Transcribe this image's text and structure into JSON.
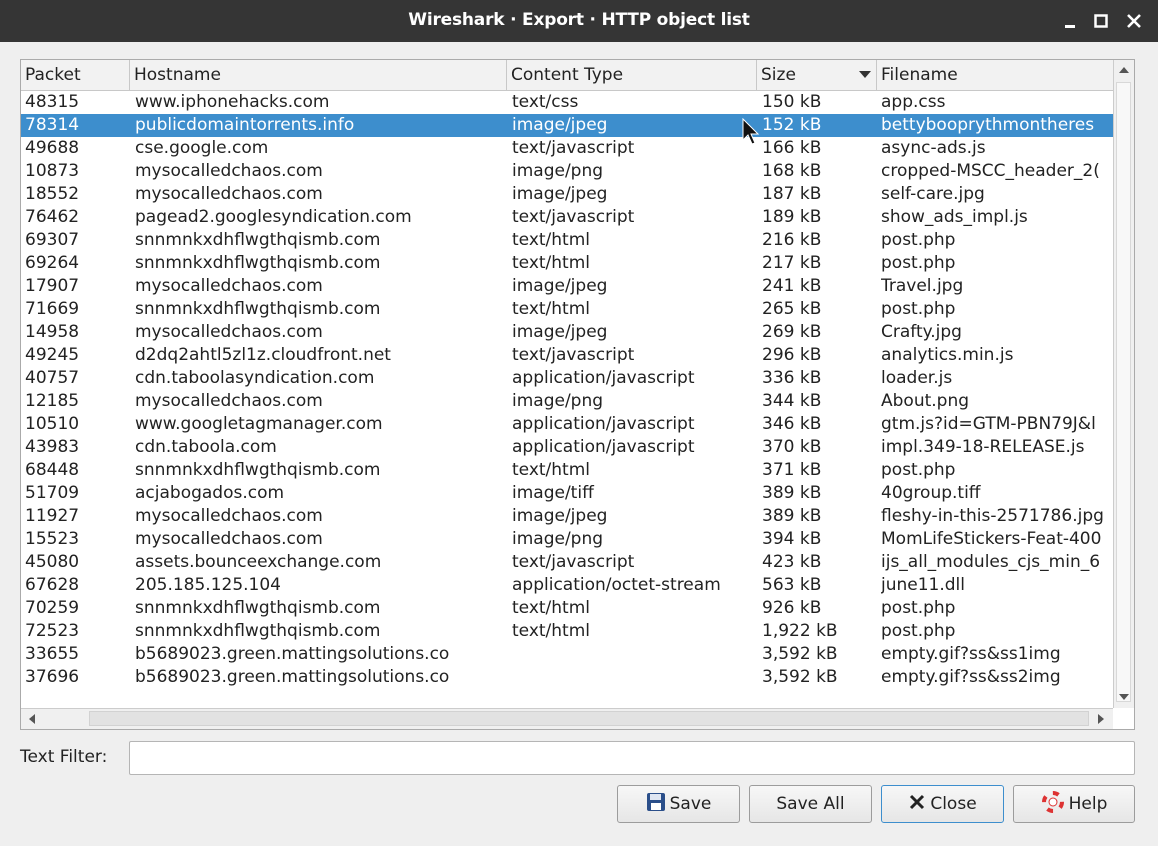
{
  "window": {
    "title": "Wireshark · Export · HTTP object list"
  },
  "table": {
    "columns": [
      "Packet",
      "Hostname",
      "Content Type",
      "Size",
      "Filename"
    ],
    "sorted_column": "Size",
    "selected_index": 1,
    "rows": [
      {
        "packet": "48315",
        "host": "www.iphonehacks.com",
        "ctype": "text/css",
        "size": "150 kB",
        "file": "app.css"
      },
      {
        "packet": "78314",
        "host": "publicdomaintorrents.info",
        "ctype": "image/jpeg",
        "size": "152 kB",
        "file": "bettybooprythmontheres"
      },
      {
        "packet": "49688",
        "host": "cse.google.com",
        "ctype": "text/javascript",
        "size": "166 kB",
        "file": "async-ads.js"
      },
      {
        "packet": "10873",
        "host": "mysocalledchaos.com",
        "ctype": "image/png",
        "size": "168 kB",
        "file": "cropped-MSCC_header_2("
      },
      {
        "packet": "18552",
        "host": "mysocalledchaos.com",
        "ctype": "image/jpeg",
        "size": "187 kB",
        "file": "self-care.jpg"
      },
      {
        "packet": "76462",
        "host": "pagead2.googlesyndication.com",
        "ctype": "text/javascript",
        "size": "189 kB",
        "file": "show_ads_impl.js"
      },
      {
        "packet": "69307",
        "host": "snnmnkxdhflwgthqismb.com",
        "ctype": "text/html",
        "size": "216 kB",
        "file": "post.php"
      },
      {
        "packet": "69264",
        "host": "snnmnkxdhflwgthqismb.com",
        "ctype": "text/html",
        "size": "217 kB",
        "file": "post.php"
      },
      {
        "packet": "17907",
        "host": "mysocalledchaos.com",
        "ctype": "image/jpeg",
        "size": "241 kB",
        "file": "Travel.jpg"
      },
      {
        "packet": "71669",
        "host": "snnmnkxdhflwgthqismb.com",
        "ctype": "text/html",
        "size": "265 kB",
        "file": "post.php"
      },
      {
        "packet": "14958",
        "host": "mysocalledchaos.com",
        "ctype": "image/jpeg",
        "size": "269 kB",
        "file": "Crafty.jpg"
      },
      {
        "packet": "49245",
        "host": "d2dq2ahtl5zl1z.cloudfront.net",
        "ctype": "text/javascript",
        "size": "296 kB",
        "file": "analytics.min.js"
      },
      {
        "packet": "40757",
        "host": "cdn.taboolasyndication.com",
        "ctype": "application/javascript",
        "size": "336 kB",
        "file": "loader.js"
      },
      {
        "packet": "12185",
        "host": "mysocalledchaos.com",
        "ctype": "image/png",
        "size": "344 kB",
        "file": "About.png"
      },
      {
        "packet": "10510",
        "host": "www.googletagmanager.com",
        "ctype": "application/javascript",
        "size": "346 kB",
        "file": "gtm.js?id=GTM-PBN79J&l"
      },
      {
        "packet": "43983",
        "host": "cdn.taboola.com",
        "ctype": "application/javascript",
        "size": "370 kB",
        "file": "impl.349-18-RELEASE.js"
      },
      {
        "packet": "68448",
        "host": "snnmnkxdhflwgthqismb.com",
        "ctype": "text/html",
        "size": "371 kB",
        "file": "post.php"
      },
      {
        "packet": "51709",
        "host": "acjabogados.com",
        "ctype": "image/tiff",
        "size": "389 kB",
        "file": "40group.tiff"
      },
      {
        "packet": "11927",
        "host": "mysocalledchaos.com",
        "ctype": "image/jpeg",
        "size": "389 kB",
        "file": "fleshy-in-this-2571786.jpg"
      },
      {
        "packet": "15523",
        "host": "mysocalledchaos.com",
        "ctype": "image/png",
        "size": "394 kB",
        "file": "MomLifeStickers-Feat-400"
      },
      {
        "packet": "45080",
        "host": "assets.bounceexchange.com",
        "ctype": "text/javascript",
        "size": "423 kB",
        "file": "ijs_all_modules_cjs_min_6"
      },
      {
        "packet": "67628",
        "host": "205.185.125.104",
        "ctype": "application/octet-stream",
        "size": "563 kB",
        "file": "june11.dll"
      },
      {
        "packet": "70259",
        "host": "snnmnkxdhflwgthqismb.com",
        "ctype": "text/html",
        "size": "926 kB",
        "file": "post.php"
      },
      {
        "packet": "72523",
        "host": "snnmnkxdhflwgthqismb.com",
        "ctype": "text/html",
        "size": "1,922 kB",
        "file": "post.php"
      },
      {
        "packet": "33655",
        "host": "b5689023.green.mattingsolutions.co",
        "ctype": "",
        "size": "3,592 kB",
        "file": "empty.gif?ss&ss1img"
      },
      {
        "packet": "37696",
        "host": "b5689023.green.mattingsolutions.co",
        "ctype": "",
        "size": "3,592 kB",
        "file": "empty.gif?ss&ss2img"
      }
    ]
  },
  "filter": {
    "label": "Text Filter:",
    "value": ""
  },
  "buttons": {
    "save": "Save",
    "save_all": "Save All",
    "close": "Close",
    "help": "Help"
  },
  "colors": {
    "selection": "#3d8ecd",
    "titlebar": "#353535"
  }
}
